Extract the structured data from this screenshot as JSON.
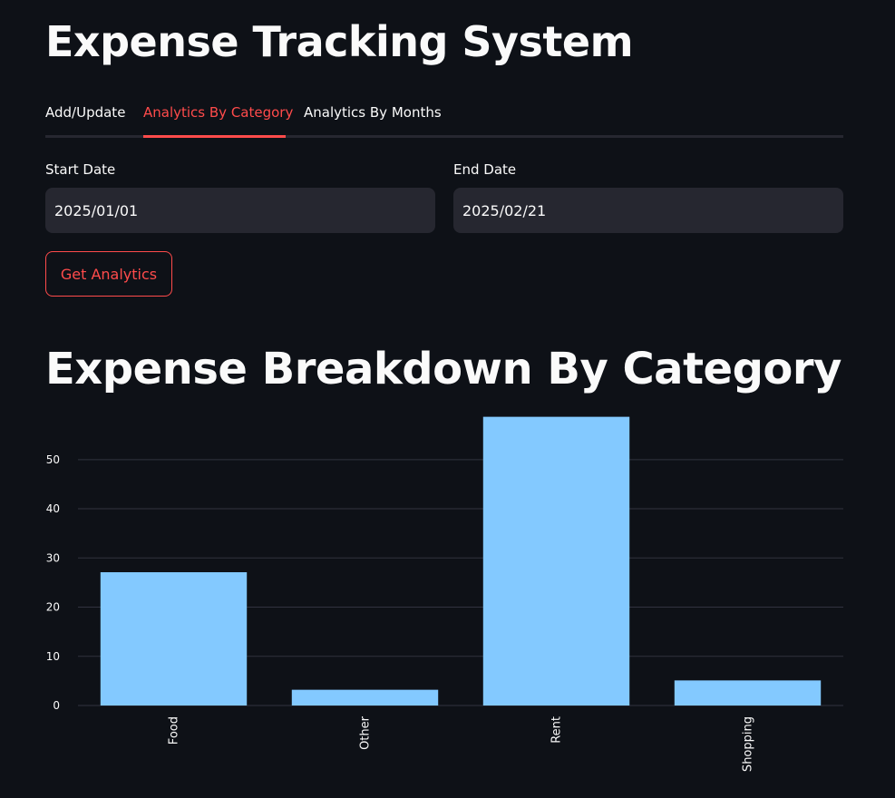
{
  "app": {
    "title": "Expense Tracking System"
  },
  "tabs": [
    {
      "label": "Add/Update",
      "active": false
    },
    {
      "label": "Analytics By Category",
      "active": true
    },
    {
      "label": "Analytics By Months",
      "active": false
    }
  ],
  "filters": {
    "start_label": "Start Date",
    "start_value": "2025/01/01",
    "end_label": "End Date",
    "end_value": "2025/02/21"
  },
  "actions": {
    "get_label": "Get Analytics"
  },
  "section": {
    "title": "Expense Breakdown By Category"
  },
  "colors": {
    "background": "#0e1117",
    "accent": "#ff4b4b",
    "input_background": "#262730",
    "bar": "#83c9ff",
    "grid": "#31333f"
  },
  "chart_data": {
    "type": "bar",
    "categories": [
      "Food",
      "Other",
      "Rent",
      "Shopping"
    ],
    "values": [
      27.1,
      3.2,
      58.7,
      5.1
    ],
    "title": "",
    "xlabel": "",
    "ylabel": "",
    "ylim": [
      0,
      59
    ],
    "yticks": [
      0,
      10,
      20,
      30,
      40,
      50
    ],
    "grid": true
  }
}
